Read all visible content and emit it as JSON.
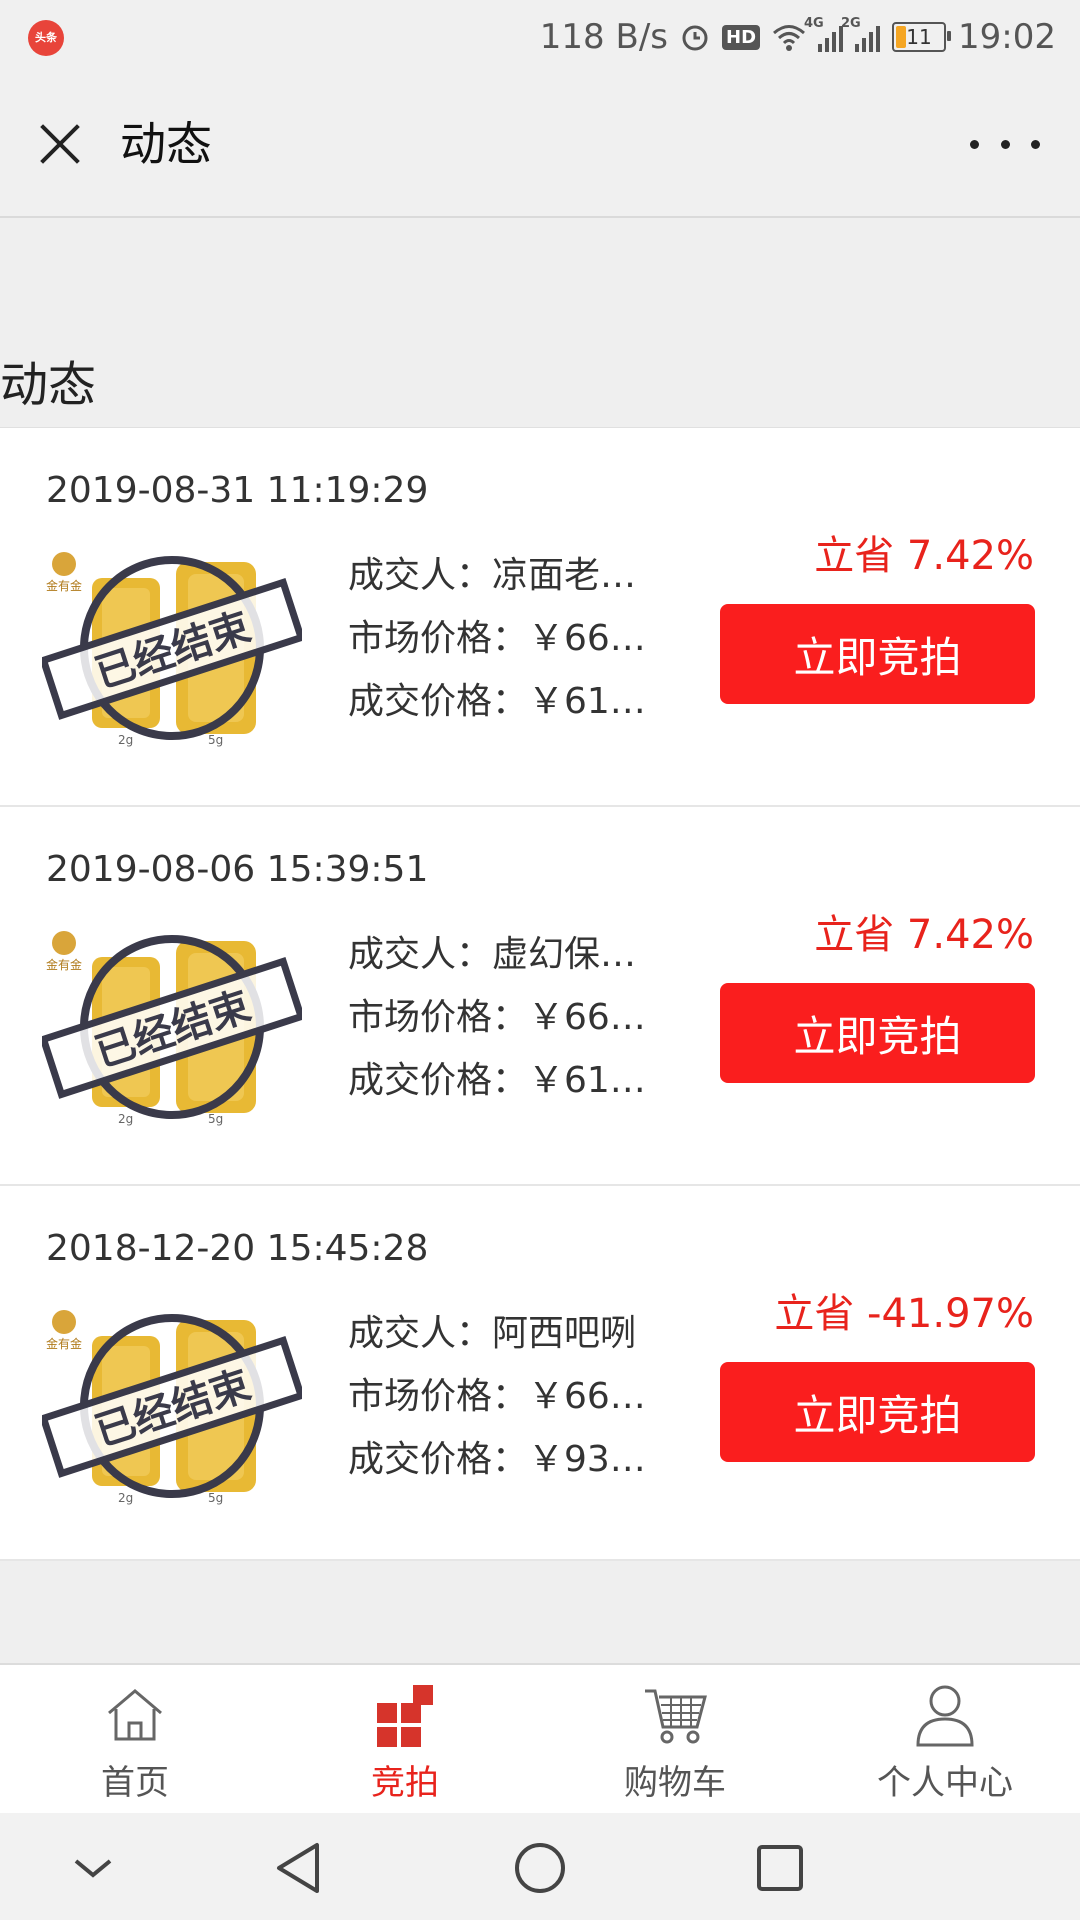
{
  "status_bar": {
    "app_icon_text": "头条",
    "network_speed": "118 B/s",
    "hd_label": "HD",
    "signal_1_tag": "4G",
    "signal_2_tag": "2G",
    "battery_level": "11",
    "time": "19:02"
  },
  "header": {
    "title": "动态"
  },
  "section": {
    "heading": "动态"
  },
  "records": [
    {
      "time": "2019-08-31 11:19:29",
      "buyer": "成交人：凉面老…",
      "market_price": "市场价格：￥66…",
      "deal_price": "成交价格：￥61…",
      "save": "立省 7.42%",
      "button": "立即竞拍",
      "stamp": "已经结束"
    },
    {
      "time": "2019-08-06 15:39:51",
      "buyer": "成交人：虚幻保…",
      "market_price": "市场价格：￥66…",
      "deal_price": "成交价格：￥61…",
      "save": "立省 7.42%",
      "button": "立即竞拍",
      "stamp": "已经结束"
    },
    {
      "time": "2018-12-20 15:45:28",
      "buyer": "成交人：阿西吧咧",
      "market_price": "市场价格：￥66…",
      "deal_price": "成交价格：￥93…",
      "save": "立省 -41.97%",
      "button": "立即竞拍",
      "stamp": "已经结束"
    }
  ],
  "product_image": {
    "brand_text": "金有金",
    "left_weight": "2g",
    "right_weight": "5g",
    "gold_color": "#e8b934"
  },
  "tabbar": {
    "tabs": [
      {
        "label": "首页",
        "icon": "home-icon",
        "active": false
      },
      {
        "label": "竞拍",
        "icon": "grid-icon",
        "active": true
      },
      {
        "label": "购物车",
        "icon": "cart-icon",
        "active": false
      },
      {
        "label": "个人中心",
        "icon": "user-icon",
        "active": false
      }
    ]
  },
  "colors": {
    "accent_red": "#fa1e1e",
    "save_red": "#e8231c"
  }
}
